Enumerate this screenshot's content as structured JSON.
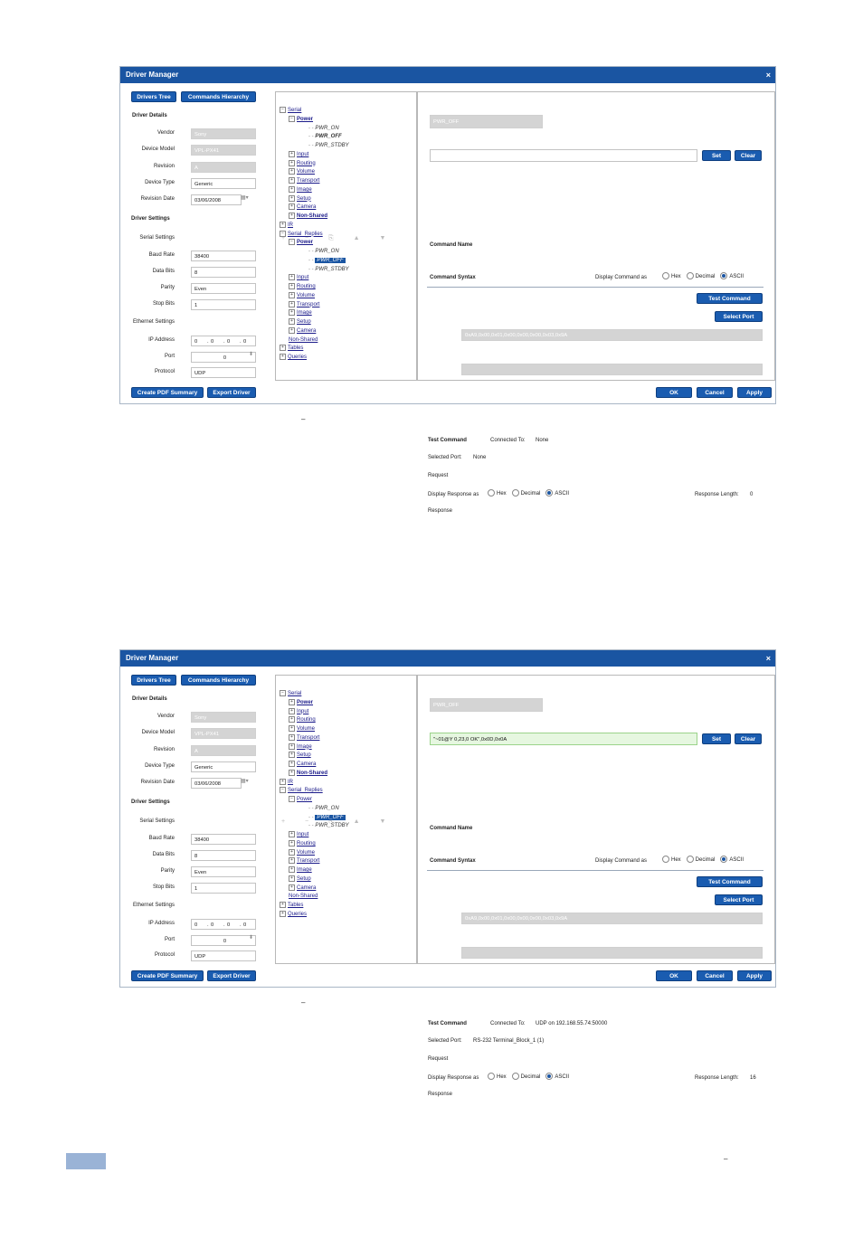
{
  "dialogs": [
    {
      "title": "Driver Manager",
      "close": "×",
      "top_buttons": [
        "Drivers Tree",
        "Commands Hierarchy"
      ],
      "driver_details": {
        "heading": "Driver Details",
        "vendor_label": "Vendor",
        "vendor": "Sony",
        "model_label": "Device Model",
        "model": "VPL-PX41",
        "revision_label": "Revision",
        "revision": "A",
        "type_label": "Device Type",
        "type": "Generic",
        "date_label": "Revision Date",
        "date": "03/06/2008"
      },
      "driver_settings": {
        "heading": "Driver Settings",
        "serial_label": "Serial Settings",
        "baud_label": "Baud Rate",
        "baud": "38400",
        "data_label": "Data Bits",
        "data": "8",
        "parity_label": "Parity",
        "parity": "Even",
        "stop_label": "Stop Bits",
        "stop": "1",
        "ethernet_label": "Ethernet Settings",
        "ip_label": "IP Address",
        "ip": [
          "0",
          "0",
          "0",
          "0"
        ],
        "port_label": "Port",
        "port": "0",
        "protocol_label": "Protocol",
        "protocol": "UDP"
      },
      "bottom_left_buttons": [
        "Create PDF Summary",
        "Export Driver"
      ],
      "toolbar_icons": "+ − ⎘ ▲ ▼",
      "tree": [
        {
          "level": 0,
          "exp": "−",
          "label": "Serial",
          "bold": false
        },
        {
          "level": 1,
          "exp": "−",
          "label": "Power",
          "bold": true
        },
        {
          "level": 2,
          "label": "PWR_ON",
          "leaf": true
        },
        {
          "level": 2,
          "label": "PWR_OFF",
          "leaf": true,
          "bold": true
        },
        {
          "level": 2,
          "label": "PWR_STDBY",
          "leaf": true
        },
        {
          "level": 1,
          "exp": "+",
          "label": "Input"
        },
        {
          "level": 1,
          "exp": "+",
          "label": "Routing"
        },
        {
          "level": 1,
          "exp": "+",
          "label": "Volume"
        },
        {
          "level": 1,
          "exp": "+",
          "label": "Transport"
        },
        {
          "level": 1,
          "exp": "+",
          "label": "Image"
        },
        {
          "level": 1,
          "exp": "+",
          "label": "Setup"
        },
        {
          "level": 1,
          "exp": "+",
          "label": "Camera"
        },
        {
          "level": 1,
          "exp": "+",
          "label": "Non-Shared",
          "bold": true
        },
        {
          "level": 0,
          "exp": "+",
          "label": "IR"
        },
        {
          "level": 0,
          "exp": "−",
          "label": "Serial_Replies"
        },
        {
          "level": 1,
          "exp": "−",
          "label": "Power",
          "bold": true
        },
        {
          "level": 2,
          "label": "PWR_ON",
          "leaf": true
        },
        {
          "level": 2,
          "label": "PWR_OFF",
          "leaf": true,
          "sel": true
        },
        {
          "level": 2,
          "label": "PWR_STDBY",
          "leaf": true
        },
        {
          "level": 1,
          "exp": "+",
          "label": "Input"
        },
        {
          "level": 1,
          "exp": "+",
          "label": "Routing"
        },
        {
          "level": 1,
          "exp": "+",
          "label": "Volume"
        },
        {
          "level": 1,
          "exp": "+",
          "label": "Transport"
        },
        {
          "level": 1,
          "exp": "+",
          "label": "Image"
        },
        {
          "level": 1,
          "exp": "+",
          "label": "Setup"
        },
        {
          "level": 1,
          "exp": "+",
          "label": "Camera"
        },
        {
          "level": 1,
          "label": "Non-Shared",
          "bold": false
        },
        {
          "level": 0,
          "exp": "+",
          "label": "Tables"
        },
        {
          "level": 0,
          "exp": "+",
          "label": "Queries"
        }
      ],
      "command": {
        "name_label": "Command Name",
        "name": "PWR_OFF",
        "syntax_label": "Command Syntax",
        "display_label": "Display Command as",
        "hex": "Hex",
        "decimal": "Decimal",
        "ascii": "ASCII",
        "syntax_value": "",
        "set": "Set",
        "clear": "Clear"
      },
      "test": {
        "heading": "Test Command",
        "connected_label": "Connected To:",
        "connected": "None",
        "test_button": "Test Command",
        "port_label": "Selected Port:",
        "port": "None",
        "select_port": "Select Port",
        "request_label": "Request",
        "request": "0xA9,0x00,0x01,0x00,0x00,0x00,0x03,0x9A",
        "display_resp_label": "Display Response as",
        "hex": "Hex",
        "decimal": "Decimal",
        "ascii": "ASCII",
        "resp_len_label": "Response Length:",
        "resp_len": "0",
        "response_label": "Response",
        "response": ""
      },
      "bottom_right_buttons": [
        "OK",
        "Cancel",
        "Apply"
      ]
    },
    {
      "title": "Driver Manager",
      "close": "×",
      "top_buttons": [
        "Drivers Tree",
        "Commands Hierarchy"
      ],
      "driver_details": {
        "heading": "Driver Details",
        "vendor_label": "Vendor",
        "vendor": "Sony",
        "model_label": "Device Model",
        "model": "VPL-PX41",
        "revision_label": "Revision",
        "revision": "A",
        "type_label": "Device Type",
        "type": "Generic",
        "date_label": "Revision Date",
        "date": "03/06/2008"
      },
      "driver_settings": {
        "heading": "Driver Settings",
        "serial_label": "Serial Settings",
        "baud_label": "Baud Rate",
        "baud": "38400",
        "data_label": "Data Bits",
        "data": "8",
        "parity_label": "Parity",
        "parity": "Even",
        "stop_label": "Stop Bits",
        "stop": "1",
        "ethernet_label": "Ethernet Settings",
        "ip_label": "IP Address",
        "ip": [
          "0",
          "0",
          "0",
          "0"
        ],
        "port_label": "Port",
        "port": "0",
        "protocol_label": "Protocol",
        "protocol": "UDP"
      },
      "bottom_left_buttons": [
        "Create PDF Summary",
        "Export Driver"
      ],
      "toolbar_icons": "+ − ⎘ ▲ ▼",
      "tree": [
        {
          "level": 0,
          "exp": "−",
          "label": "Serial"
        },
        {
          "level": 1,
          "exp": "+",
          "label": "Power",
          "bold": true
        },
        {
          "level": 1,
          "exp": "+",
          "label": "Input"
        },
        {
          "level": 1,
          "exp": "+",
          "label": "Routing"
        },
        {
          "level": 1,
          "exp": "+",
          "label": "Volume"
        },
        {
          "level": 1,
          "exp": "+",
          "label": "Transport"
        },
        {
          "level": 1,
          "exp": "+",
          "label": "Image"
        },
        {
          "level": 1,
          "exp": "+",
          "label": "Setup"
        },
        {
          "level": 1,
          "exp": "+",
          "label": "Camera"
        },
        {
          "level": 1,
          "exp": "+",
          "label": "Non-Shared",
          "bold": true
        },
        {
          "level": 0,
          "exp": "+",
          "label": "IR"
        },
        {
          "level": 0,
          "exp": "−",
          "label": "Serial_Replies"
        },
        {
          "level": 1,
          "exp": "−",
          "label": "Power"
        },
        {
          "level": 2,
          "label": "PWR_ON",
          "leaf": true
        },
        {
          "level": 2,
          "label": "PWR_OFF",
          "leaf": true,
          "sel": true
        },
        {
          "level": 2,
          "label": "PWR_STDBY",
          "leaf": true
        },
        {
          "level": 1,
          "exp": "+",
          "label": "Input"
        },
        {
          "level": 1,
          "exp": "+",
          "label": "Routing"
        },
        {
          "level": 1,
          "exp": "+",
          "label": "Volume"
        },
        {
          "level": 1,
          "exp": "+",
          "label": "Transport"
        },
        {
          "level": 1,
          "exp": "+",
          "label": "Image"
        },
        {
          "level": 1,
          "exp": "+",
          "label": "Setup"
        },
        {
          "level": 1,
          "exp": "+",
          "label": "Camera"
        },
        {
          "level": 1,
          "label": "Non-Shared"
        },
        {
          "level": 0,
          "exp": "+",
          "label": "Tables"
        },
        {
          "level": 0,
          "exp": "+",
          "label": "Queries"
        }
      ],
      "command": {
        "name_label": "Command Name",
        "name": "PWR_OFF",
        "syntax_label": "Command Syntax",
        "display_label": "Display Command as",
        "hex": "Hex",
        "decimal": "Decimal",
        "ascii": "ASCII",
        "syntax_value": "\"~01@Y 0,23,0 OK\",0x0D,0x0A",
        "set": "Set",
        "clear": "Clear"
      },
      "test": {
        "heading": "Test Command",
        "connected_label": "Connected To:",
        "connected": "UDP on 192.168.55.74:50000",
        "test_button": "Test Command",
        "port_label": "Selected Port:",
        "port": "RS-232 Terminal_Block_1 (1)",
        "select_port": "Select Port",
        "request_label": "Request",
        "request": "0xA9,0x00,0x01,0x00,0x00,0x00,0x03,0x9A",
        "display_resp_label": "Display Response as",
        "hex": "Hex",
        "decimal": "Decimal",
        "ascii": "ASCII",
        "resp_len_label": "Response Length:",
        "resp_len": "16",
        "response_label": "Response",
        "response": ""
      },
      "bottom_right_buttons": [
        "OK",
        "Cancel",
        "Apply"
      ]
    }
  ],
  "colors": {
    "titlebar": "#1a55a2",
    "button": "#1a5cb0",
    "disabled": "#d4d4d4",
    "syntax_filled": "#e6f7e0",
    "footer_box": "#9ab3d6"
  },
  "dash_marks": [
    "–",
    "–",
    "–"
  ]
}
